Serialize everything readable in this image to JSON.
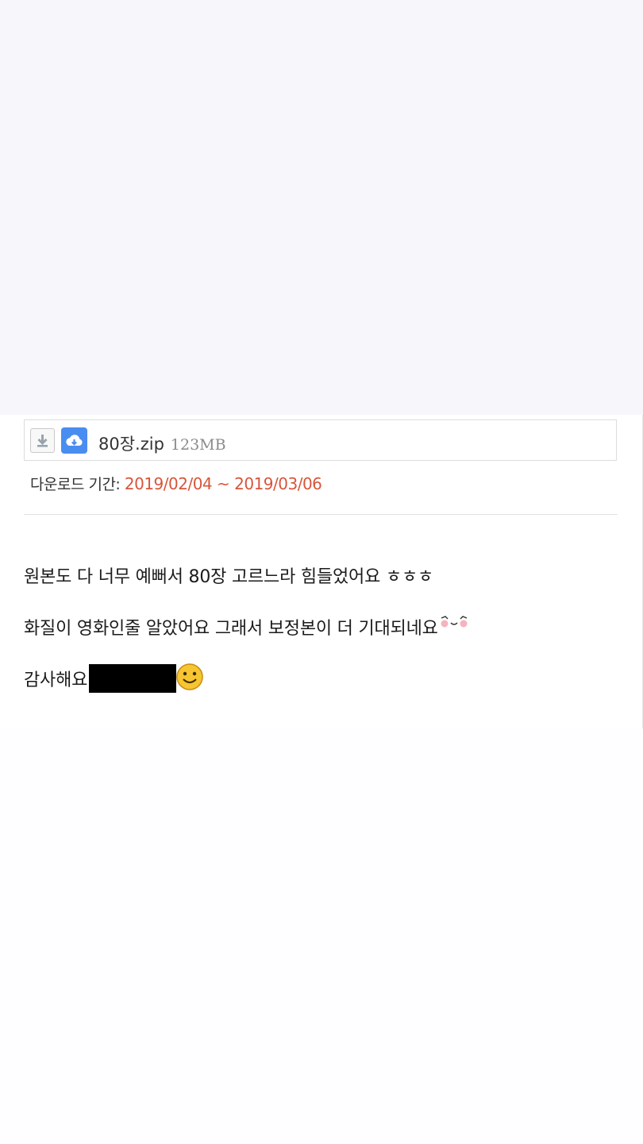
{
  "attachment": {
    "file_name": "80장.zip",
    "file_size": "123MB",
    "download_icon": "download-icon",
    "cloud_icon": "cloud-save-icon"
  },
  "download_period": {
    "label": "다운로드 기간: ",
    "value": "2019/02/04 ~ 2019/03/06"
  },
  "comment": {
    "line1": "원본도 다 너무 예뻐서 80장 고르느라 힘들었어요 ㅎㅎㅎ",
    "line2": "화질이 영화인줄 알았어요 그래서 보정본이 더 기대되네요",
    "line3": "감사해요"
  },
  "colors": {
    "accent_blue": "#4a8df0",
    "period_red": "#d8553a",
    "background": "#ffffff"
  }
}
